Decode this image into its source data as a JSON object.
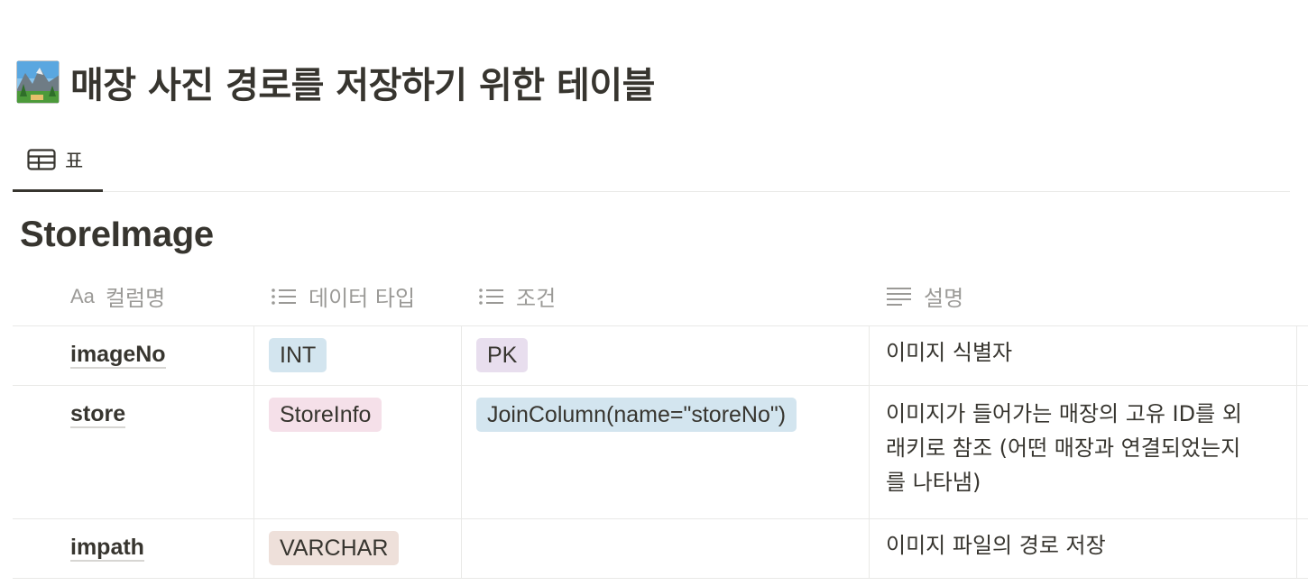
{
  "page": {
    "icon": "national-park-photo-icon",
    "title": "매장 사진 경로를 저장하기 위한 테이블"
  },
  "views": [
    {
      "icon": "table-icon",
      "label": "표",
      "active": true
    }
  ],
  "database": {
    "title": "StoreImage"
  },
  "columns": [
    {
      "icon": "text-property-icon",
      "icon_text": "Aa",
      "label": "컬럼명"
    },
    {
      "icon": "multi-select-icon",
      "label": "데이터 타입"
    },
    {
      "icon": "multi-select-icon",
      "label": "조건"
    },
    {
      "icon": "text-lines-icon",
      "label": "설명"
    }
  ],
  "rows": [
    {
      "name": "imageNo",
      "type": {
        "label": "INT",
        "color": "#d3e5ef"
      },
      "condition": {
        "label": "PK",
        "color": "#e8deee"
      },
      "description": "이미지 식별자"
    },
    {
      "name": "store",
      "type": {
        "label": "StoreInfo",
        "color": "#f5e0e9"
      },
      "condition": {
        "label": "JoinColumn(name=\"storeNo\")",
        "color": "#d3e5ef"
      },
      "description_lines": [
        "이미지가 들어가는 매장의 고유 ID를 외",
        "래키로 참조 (어떤 매장과 연결되었는지",
        "를 나타냄)"
      ]
    },
    {
      "name": "impath",
      "type": {
        "label": "VARCHAR",
        "color": "#eee0da"
      },
      "condition": null,
      "description": "이미지 파일의 경로 저장"
    }
  ],
  "colors": {
    "text": "#37352f",
    "muted": "#9b9a97",
    "border": "#e9e9e7"
  }
}
